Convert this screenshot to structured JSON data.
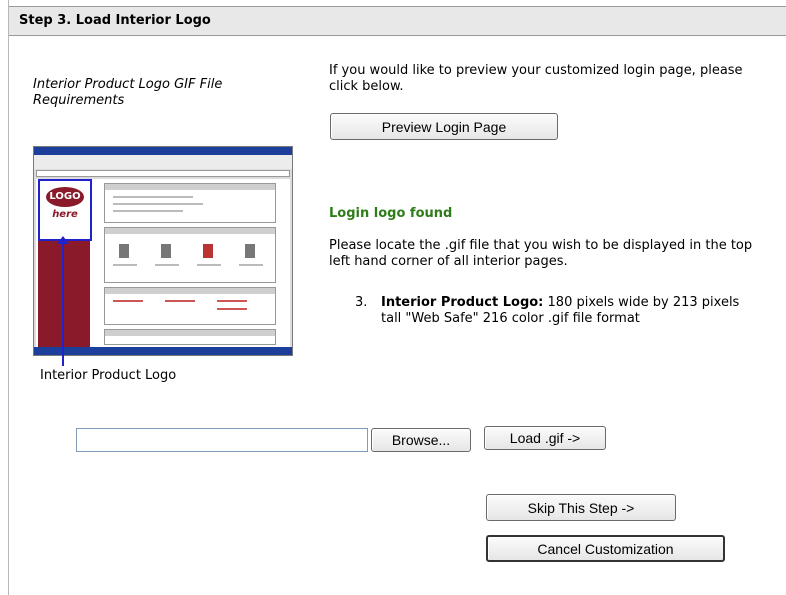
{
  "header": {
    "title": "Step 3. Load Interior Logo"
  },
  "requirements": {
    "title": "Interior Product Logo GIF File Requirements"
  },
  "preview": {
    "intro": "If you would like to preview your customized login page, please click below.",
    "button_label": "Preview Login Page"
  },
  "status": {
    "found": "Login logo found",
    "locate": "Please locate the .gif file that you wish to be displayed in the top left hand corner of all interior pages."
  },
  "spec": {
    "number": "3.",
    "label": "Interior Product Logo:",
    "text": " 180 pixels wide by 213 pixels tall \"Web Safe\" 216 color .gif file format"
  },
  "thumbnail": {
    "logo_text": "LOGO",
    "logo_sub": "here"
  },
  "caption": "Interior Product Logo",
  "file": {
    "value": "",
    "browse_label": "Browse...",
    "load_label": "Load .gif ->"
  },
  "actions": {
    "skip_label": "Skip This Step ->",
    "cancel_label": "Cancel Customization"
  },
  "colors": {
    "found_green": "#2e7d1a",
    "logo_maroon": "#8a1a2a",
    "pointer_blue": "#2222cc"
  }
}
